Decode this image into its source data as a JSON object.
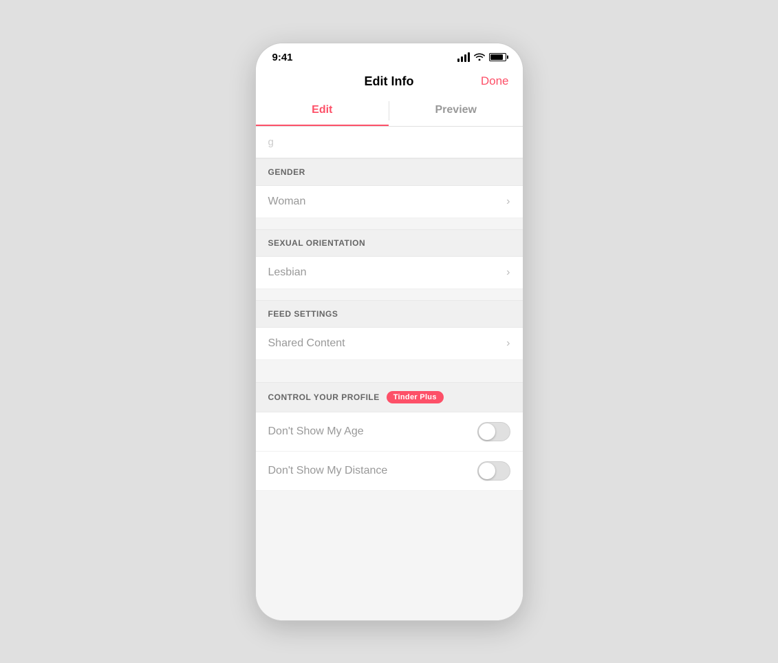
{
  "statusBar": {
    "time": "9:41"
  },
  "navBar": {
    "title": "Edit Info",
    "doneLabel": "Done"
  },
  "tabs": [
    {
      "label": "Edit",
      "active": true
    },
    {
      "label": "Preview",
      "active": false
    }
  ],
  "sections": [
    {
      "header": "GENDER",
      "items": [
        {
          "label": "Woman",
          "hasChevron": true
        }
      ]
    },
    {
      "header": "SEXUAL ORIENTATION",
      "items": [
        {
          "label": "Lesbian",
          "hasChevron": true
        }
      ]
    },
    {
      "header": "FEED SETTINGS",
      "items": [
        {
          "label": "Shared Content",
          "hasChevron": true
        }
      ]
    }
  ],
  "controlSection": {
    "header": "CONTROL YOUR PROFILE",
    "badge": "Tinder Plus",
    "toggles": [
      {
        "label": "Don't Show My Age",
        "enabled": false
      },
      {
        "label": "Don't Show My Distance",
        "enabled": false
      }
    ]
  }
}
